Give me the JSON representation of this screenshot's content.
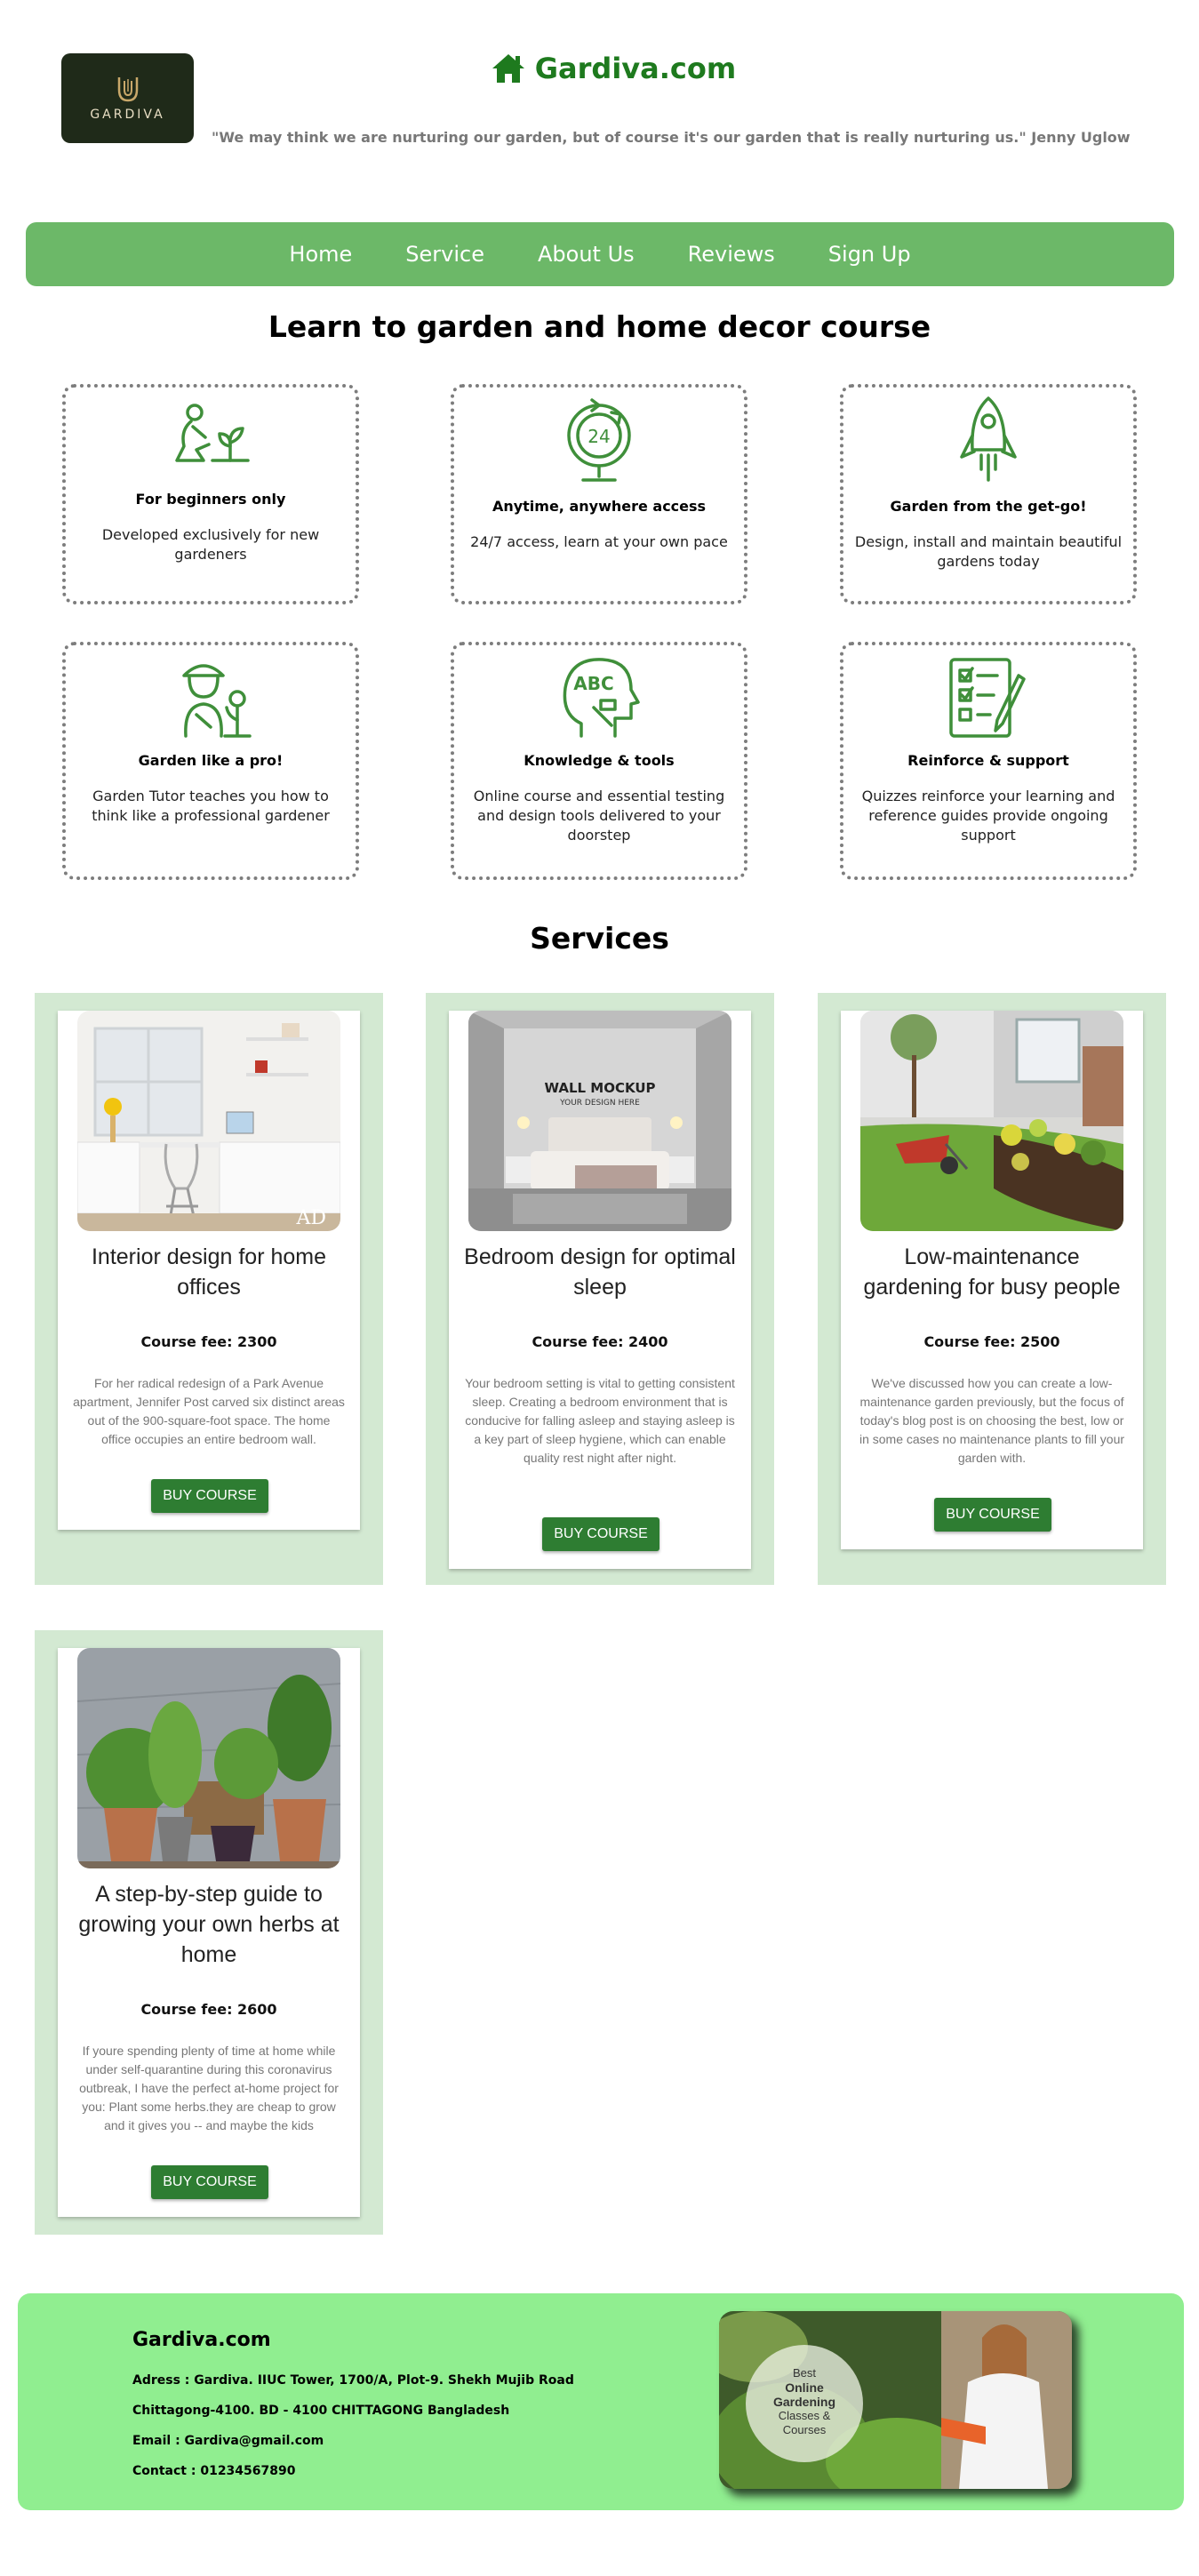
{
  "header": {
    "logo_text": "GARDIVA",
    "site_title": "Gardiva.com",
    "quote": "\"We may think we are nurturing our garden, but of course it's our garden that is really nurturing us.\" Jenny Uglow"
  },
  "nav": {
    "items": [
      "Home",
      "Service",
      "About Us",
      "Reviews",
      "Sign Up"
    ]
  },
  "course_section": {
    "title": "Learn to garden and home decor course",
    "features": [
      {
        "icon": "gardener-planting-icon",
        "title": "For beginners only",
        "text": "Developed exclusively for new gardeners"
      },
      {
        "icon": "24-hour-globe-icon",
        "title": "Anytime, anywhere access",
        "text": "24/7 access, learn at your own pace"
      },
      {
        "icon": "rocket-flower-icon",
        "title": "Garden from the get-go!",
        "text": "Design, install and maintain beautiful gardens today"
      },
      {
        "icon": "female-gardener-icon",
        "title": "Garden like a pro!",
        "text": "Garden Tutor teaches you how to think like a professional gardener"
      },
      {
        "icon": "abc-head-tools-icon",
        "title": "Knowledge & tools",
        "text": "Online course and essential testing and design tools delivered to your doorstep"
      },
      {
        "icon": "checklist-pencil-icon",
        "title": "Reinforce & support",
        "text": "Quizzes reinforce your learning and reference guides provide ongoing support"
      }
    ]
  },
  "services": {
    "title": "Services",
    "cards": [
      {
        "title": "Interior design for home offices",
        "fee": "Course fee: 2300",
        "desc": "For her radical redesign of a Park Avenue apartment, Jennifer Post carved six distinct areas out of the 900-square-foot space. The home office occupies an entire bedroom wall.",
        "button": "BUY COURSE",
        "image_watermark": "AD"
      },
      {
        "title": "Bedroom design for optimal sleep",
        "fee": "Course fee: 2400",
        "desc": "Your bedroom setting is vital to getting consistent sleep. Creating a bedroom environment that is conducive for falling asleep and staying asleep is a key part of sleep hygiene, which can enable quality rest night after night.",
        "button": "BUY COURSE",
        "image_text_1": "WALL MOCKUP",
        "image_text_2": "YOUR DESIGN HERE"
      },
      {
        "title": "Low-maintenance gardening for busy people",
        "fee": "Course fee: 2500",
        "desc": "We've discussed how you can create a low-maintenance garden previously, but the focus of today's blog post is on choosing the best, low or in some cases no maintenance plants to fill your garden with.",
        "button": "BUY COURSE"
      },
      {
        "title": "A step-by-step guide to growing your own herbs at home",
        "fee": "Course fee: 2600",
        "desc": "If youre spending plenty of time at home while under self-quarantine during this coronavirus outbreak, I have the perfect at-home project for you: Plant some herbs.they are cheap to grow and it gives you -- and maybe the kids",
        "button": "BUY COURSE"
      }
    ]
  },
  "footer": {
    "title": "Gardiva.com",
    "address_1": "Adress : Gardiva. IIUC Tower, 1700/A, Plot-9. Shekh Mujib Road",
    "address_2": "Chittagong-4100. BD - 4100 CHITTAGONG Bangladesh",
    "email": "Email : Gardiva@gmail.com",
    "contact": "Contact : 01234567890",
    "image_text": [
      "Best",
      "Online",
      "Gardening",
      "Classes &",
      "Courses"
    ]
  },
  "colors": {
    "brand_green": "#1e7a1e",
    "nav_bg": "#6cb868",
    "service_bg": "#d3e9d2",
    "button": "#2e7d32",
    "footer_bg": "#90ee90"
  }
}
